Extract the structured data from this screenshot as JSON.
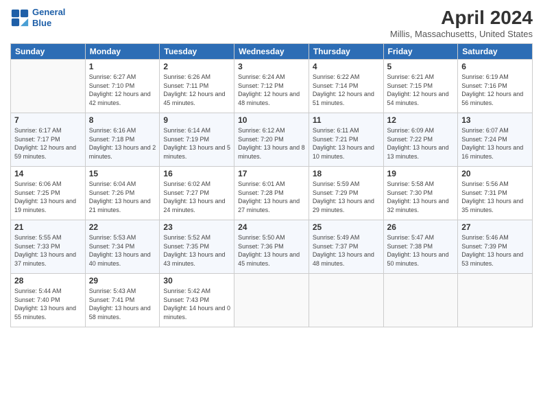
{
  "header": {
    "logo": {
      "line1": "General",
      "line2": "Blue"
    },
    "title": "April 2024",
    "subtitle": "Millis, Massachusetts, United States"
  },
  "weekdays": [
    "Sunday",
    "Monday",
    "Tuesday",
    "Wednesday",
    "Thursday",
    "Friday",
    "Saturday"
  ],
  "weeks": [
    [
      {
        "day": "",
        "sunrise": "",
        "sunset": "",
        "daylight": ""
      },
      {
        "day": "1",
        "sunrise": "6:27 AM",
        "sunset": "7:10 PM",
        "daylight": "12 hours and 42 minutes."
      },
      {
        "day": "2",
        "sunrise": "6:26 AM",
        "sunset": "7:11 PM",
        "daylight": "12 hours and 45 minutes."
      },
      {
        "day": "3",
        "sunrise": "6:24 AM",
        "sunset": "7:12 PM",
        "daylight": "12 hours and 48 minutes."
      },
      {
        "day": "4",
        "sunrise": "6:22 AM",
        "sunset": "7:14 PM",
        "daylight": "12 hours and 51 minutes."
      },
      {
        "day": "5",
        "sunrise": "6:21 AM",
        "sunset": "7:15 PM",
        "daylight": "12 hours and 54 minutes."
      },
      {
        "day": "6",
        "sunrise": "6:19 AM",
        "sunset": "7:16 PM",
        "daylight": "12 hours and 56 minutes."
      }
    ],
    [
      {
        "day": "7",
        "sunrise": "6:17 AM",
        "sunset": "7:17 PM",
        "daylight": "12 hours and 59 minutes."
      },
      {
        "day": "8",
        "sunrise": "6:16 AM",
        "sunset": "7:18 PM",
        "daylight": "13 hours and 2 minutes."
      },
      {
        "day": "9",
        "sunrise": "6:14 AM",
        "sunset": "7:19 PM",
        "daylight": "13 hours and 5 minutes."
      },
      {
        "day": "10",
        "sunrise": "6:12 AM",
        "sunset": "7:20 PM",
        "daylight": "13 hours and 8 minutes."
      },
      {
        "day": "11",
        "sunrise": "6:11 AM",
        "sunset": "7:21 PM",
        "daylight": "13 hours and 10 minutes."
      },
      {
        "day": "12",
        "sunrise": "6:09 AM",
        "sunset": "7:22 PM",
        "daylight": "13 hours and 13 minutes."
      },
      {
        "day": "13",
        "sunrise": "6:07 AM",
        "sunset": "7:24 PM",
        "daylight": "13 hours and 16 minutes."
      }
    ],
    [
      {
        "day": "14",
        "sunrise": "6:06 AM",
        "sunset": "7:25 PM",
        "daylight": "13 hours and 19 minutes."
      },
      {
        "day": "15",
        "sunrise": "6:04 AM",
        "sunset": "7:26 PM",
        "daylight": "13 hours and 21 minutes."
      },
      {
        "day": "16",
        "sunrise": "6:02 AM",
        "sunset": "7:27 PM",
        "daylight": "13 hours and 24 minutes."
      },
      {
        "day": "17",
        "sunrise": "6:01 AM",
        "sunset": "7:28 PM",
        "daylight": "13 hours and 27 minutes."
      },
      {
        "day": "18",
        "sunrise": "5:59 AM",
        "sunset": "7:29 PM",
        "daylight": "13 hours and 29 minutes."
      },
      {
        "day": "19",
        "sunrise": "5:58 AM",
        "sunset": "7:30 PM",
        "daylight": "13 hours and 32 minutes."
      },
      {
        "day": "20",
        "sunrise": "5:56 AM",
        "sunset": "7:31 PM",
        "daylight": "13 hours and 35 minutes."
      }
    ],
    [
      {
        "day": "21",
        "sunrise": "5:55 AM",
        "sunset": "7:33 PM",
        "daylight": "13 hours and 37 minutes."
      },
      {
        "day": "22",
        "sunrise": "5:53 AM",
        "sunset": "7:34 PM",
        "daylight": "13 hours and 40 minutes."
      },
      {
        "day": "23",
        "sunrise": "5:52 AM",
        "sunset": "7:35 PM",
        "daylight": "13 hours and 43 minutes."
      },
      {
        "day": "24",
        "sunrise": "5:50 AM",
        "sunset": "7:36 PM",
        "daylight": "13 hours and 45 minutes."
      },
      {
        "day": "25",
        "sunrise": "5:49 AM",
        "sunset": "7:37 PM",
        "daylight": "13 hours and 48 minutes."
      },
      {
        "day": "26",
        "sunrise": "5:47 AM",
        "sunset": "7:38 PM",
        "daylight": "13 hours and 50 minutes."
      },
      {
        "day": "27",
        "sunrise": "5:46 AM",
        "sunset": "7:39 PM",
        "daylight": "13 hours and 53 minutes."
      }
    ],
    [
      {
        "day": "28",
        "sunrise": "5:44 AM",
        "sunset": "7:40 PM",
        "daylight": "13 hours and 55 minutes."
      },
      {
        "day": "29",
        "sunrise": "5:43 AM",
        "sunset": "7:41 PM",
        "daylight": "13 hours and 58 minutes."
      },
      {
        "day": "30",
        "sunrise": "5:42 AM",
        "sunset": "7:43 PM",
        "daylight": "14 hours and 0 minutes."
      },
      {
        "day": "",
        "sunrise": "",
        "sunset": "",
        "daylight": ""
      },
      {
        "day": "",
        "sunrise": "",
        "sunset": "",
        "daylight": ""
      },
      {
        "day": "",
        "sunrise": "",
        "sunset": "",
        "daylight": ""
      },
      {
        "day": "",
        "sunrise": "",
        "sunset": "",
        "daylight": ""
      }
    ]
  ],
  "labels": {
    "sunrise": "Sunrise:",
    "sunset": "Sunset:",
    "daylight": "Daylight:"
  }
}
